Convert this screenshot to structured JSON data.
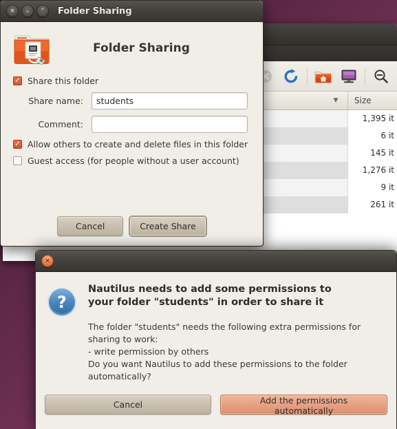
{
  "desktop": {
    "background_color": "#5c2747"
  },
  "file_manager": {
    "window_name": "nautilus-file-manager",
    "toolbar": {
      "buttons": [
        {
          "name": "stop-icon",
          "label": "Stop",
          "enabled": false
        },
        {
          "name": "reload-icon",
          "label": "Reload",
          "enabled": true
        },
        {
          "name": "home-folder-icon",
          "label": "Home",
          "enabled": true
        },
        {
          "name": "computer-icon",
          "label": "Computer",
          "enabled": true
        },
        {
          "name": "zoom-out-icon",
          "label": "Zoom Out",
          "enabled": true
        }
      ]
    },
    "columns": {
      "size_header": "Size",
      "sort_arrow": "▼"
    },
    "rows": [
      {
        "name": "",
        "size": "1,395 it"
      },
      {
        "name": "",
        "size": "6 it"
      },
      {
        "name": "",
        "size": "145 it"
      },
      {
        "name": "",
        "size": "1,276 it"
      },
      {
        "name": "",
        "size": "9 it"
      },
      {
        "name": "",
        "size": "261 it"
      }
    ]
  },
  "folder_sharing_dialog": {
    "titlebar": {
      "title": "Folder Sharing",
      "buttons": [
        {
          "name": "close-button",
          "glyph": "×"
        },
        {
          "name": "minimize-button",
          "glyph": "⌄"
        },
        {
          "name": "maximize-button",
          "glyph": "⌃"
        }
      ]
    },
    "heading": "Folder Sharing",
    "icon_name": "shared-folder-icon",
    "share_this_folder": {
      "label": "Share this folder",
      "checked": true,
      "check_glyph": "✓"
    },
    "share_name": {
      "label": "Share name:",
      "value": "students",
      "placeholder": ""
    },
    "comment": {
      "label": "Comment:",
      "value": "",
      "placeholder": ""
    },
    "allow_others": {
      "label": "Allow others to create and delete files in this folder",
      "checked": true,
      "check_glyph": "✓"
    },
    "guest_access": {
      "label": "Guest access (for people without a user account)",
      "checked": false,
      "check_glyph": ""
    },
    "buttons": {
      "cancel": "Cancel",
      "create_share": "Create Share"
    }
  },
  "permissions_dialog": {
    "titlebar": {
      "close_button_glyph": "×",
      "close_button_name": "close-button"
    },
    "icon_name": "question-mark-icon",
    "icon_glyph": "?",
    "primary_text": "Nautilus needs to add some permissions to your folder \"students\" in order to share it",
    "secondary_text": "The folder \"students\" needs the following extra permissions for sharing to work:\n  - write permission by others\nDo you want Nautilus to add these permissions to the folder automatically?",
    "buttons": {
      "cancel": "Cancel",
      "add_permissions": "Add the permissions automatically"
    }
  },
  "colors": {
    "accent_orange": "#dd4814",
    "dialog_bg": "#f1eee8",
    "titlebar_dark": "#3b3835",
    "desktop_purple": "#5c2747"
  }
}
